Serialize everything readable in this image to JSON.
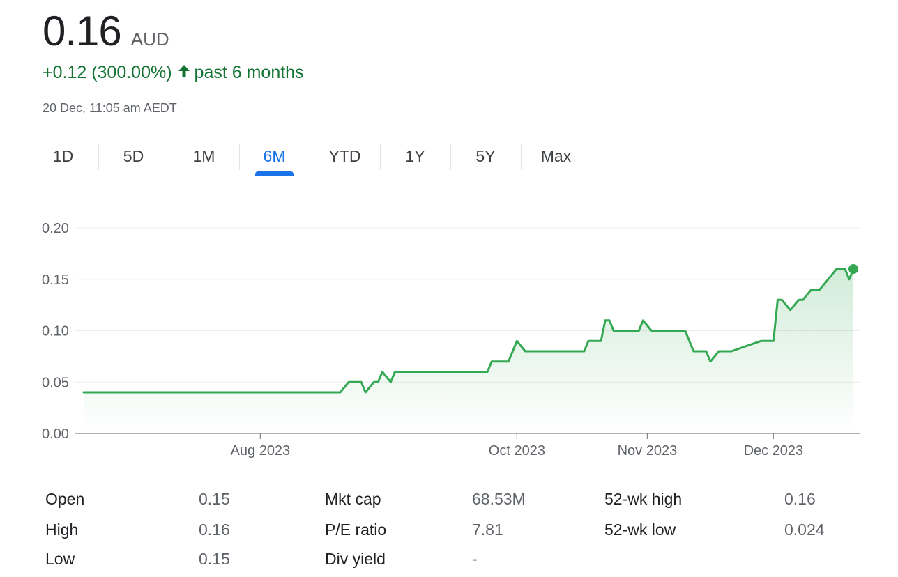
{
  "header": {
    "price": "0.16",
    "currency": "AUD",
    "change": "+0.12 (300.00%)",
    "period": "past 6 months",
    "timestamp": "20 Dec, 11:05 am AEDT"
  },
  "colors": {
    "line": "#34a853",
    "change_text": "#137333",
    "active_tab": "#1a73e8"
  },
  "tabs": [
    {
      "label": "1D"
    },
    {
      "label": "5D"
    },
    {
      "label": "1M"
    },
    {
      "label": "6M"
    },
    {
      "label": "YTD"
    },
    {
      "label": "1Y"
    },
    {
      "label": "5Y"
    },
    {
      "label": "Max"
    }
  ],
  "active_tab": "6M",
  "chart_data": {
    "type": "line",
    "x_start": "2023-06-20",
    "x_end": "2023-12-20",
    "ylim": [
      0,
      0.2
    ],
    "y_ticks": [
      "0.00",
      "0.05",
      "0.10",
      "0.15",
      "0.20"
    ],
    "x_ticks": [
      {
        "label": "Aug 2023",
        "date": "2023-08-01"
      },
      {
        "label": "Oct 2023",
        "date": "2023-10-01"
      },
      {
        "label": "Nov 2023",
        "date": "2023-11-01"
      },
      {
        "label": "Dec 2023",
        "date": "2023-12-01"
      }
    ],
    "series": [
      {
        "dates": [
          "2023-06-20",
          "2023-08-01",
          "2023-08-20",
          "2023-08-22",
          "2023-08-25",
          "2023-08-26",
          "2023-08-28",
          "2023-08-29",
          "2023-08-30",
          "2023-09-01",
          "2023-09-02",
          "2023-09-04",
          "2023-09-15",
          "2023-09-24",
          "2023-09-25",
          "2023-09-29",
          "2023-10-01",
          "2023-10-03",
          "2023-10-10",
          "2023-10-17",
          "2023-10-18",
          "2023-10-21",
          "2023-10-22",
          "2023-10-23",
          "2023-10-24",
          "2023-10-27",
          "2023-10-30",
          "2023-10-31",
          "2023-11-02",
          "2023-11-10",
          "2023-11-12",
          "2023-11-15",
          "2023-11-16",
          "2023-11-18",
          "2023-11-21",
          "2023-11-28",
          "2023-11-30",
          "2023-12-01",
          "2023-12-02",
          "2023-12-03",
          "2023-12-05",
          "2023-12-07",
          "2023-12-08",
          "2023-12-10",
          "2023-12-12",
          "2023-12-14",
          "2023-12-16",
          "2023-12-18",
          "2023-12-19",
          "2023-12-20"
        ],
        "values": [
          0.04,
          0.04,
          0.04,
          0.05,
          0.05,
          0.04,
          0.05,
          0.05,
          0.06,
          0.05,
          0.06,
          0.06,
          0.06,
          0.06,
          0.07,
          0.07,
          0.09,
          0.08,
          0.08,
          0.08,
          0.09,
          0.09,
          0.11,
          0.11,
          0.1,
          0.1,
          0.1,
          0.11,
          0.1,
          0.1,
          0.08,
          0.08,
          0.07,
          0.08,
          0.08,
          0.09,
          0.09,
          0.09,
          0.13,
          0.13,
          0.12,
          0.13,
          0.13,
          0.14,
          0.14,
          0.15,
          0.16,
          0.16,
          0.15,
          0.16
        ]
      }
    ]
  },
  "stats": [
    {
      "label": "Open",
      "value": "0.15"
    },
    {
      "label": "High",
      "value": "0.16"
    },
    {
      "label": "Low",
      "value": "0.15"
    },
    {
      "label": "Mkt cap",
      "value": "68.53M"
    },
    {
      "label": "P/E ratio",
      "value": "7.81"
    },
    {
      "label": "Div yield",
      "value": "-"
    },
    {
      "label": "52-wk high",
      "value": "0.16"
    },
    {
      "label": "52-wk low",
      "value": "0.024"
    }
  ]
}
